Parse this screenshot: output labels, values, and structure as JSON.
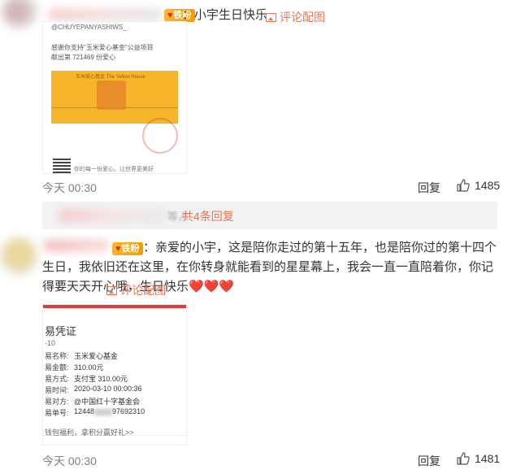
{
  "comments": [
    {
      "badge": "铁粉",
      "text": "：小宇生日快乐",
      "view_image_label": "评论配图",
      "image": {
        "top_line": "@CHUYEPANYASHIWS_",
        "line1": "感谢你支持\"玉米爱心基金\"公益项目",
        "line2": "献出第 721469 份爱心",
        "banner_text": "玉米爱心基金 The Yellow House",
        "footer": "你的每一份爱心，让世界更美好"
      },
      "time": "今天 00:30",
      "reply_label": "回复",
      "likes": "1485"
    },
    {
      "badge": "铁粉",
      "text": "：亲爱的小宇，这是陪你走过的第十五年，也是陪你过的第十四个生日，我依旧还在这里，在你转身就能看到的星星幕上，我会一直一直陪着你，你记得要天天开心哦，生日快乐❤️❤️❤️",
      "view_image_label": "评论配图",
      "receipt": {
        "title": "易凭证",
        "date": "-10",
        "rows": [
          {
            "k": "易名称:",
            "v": "玉米爱心基金"
          },
          {
            "k": "易金额:",
            "v": "310.00元"
          },
          {
            "k": "易方式:",
            "v": "支付宝 310.00元"
          },
          {
            "k": "易时间:",
            "v": "2020-03-10 00:00:36"
          },
          {
            "k": "易对方:",
            "v": "@中国红十字基金会"
          },
          {
            "k": "易单号:",
            "v": "12448",
            "v2": "97692310"
          }
        ],
        "footer": "钱包福利，拿积分赢好礼>>"
      },
      "time": "今天 00:30",
      "reply_label": "回复",
      "likes": "1481"
    }
  ],
  "sub_reply": {
    "faded_name": "等人",
    "label": "共4条回复"
  }
}
